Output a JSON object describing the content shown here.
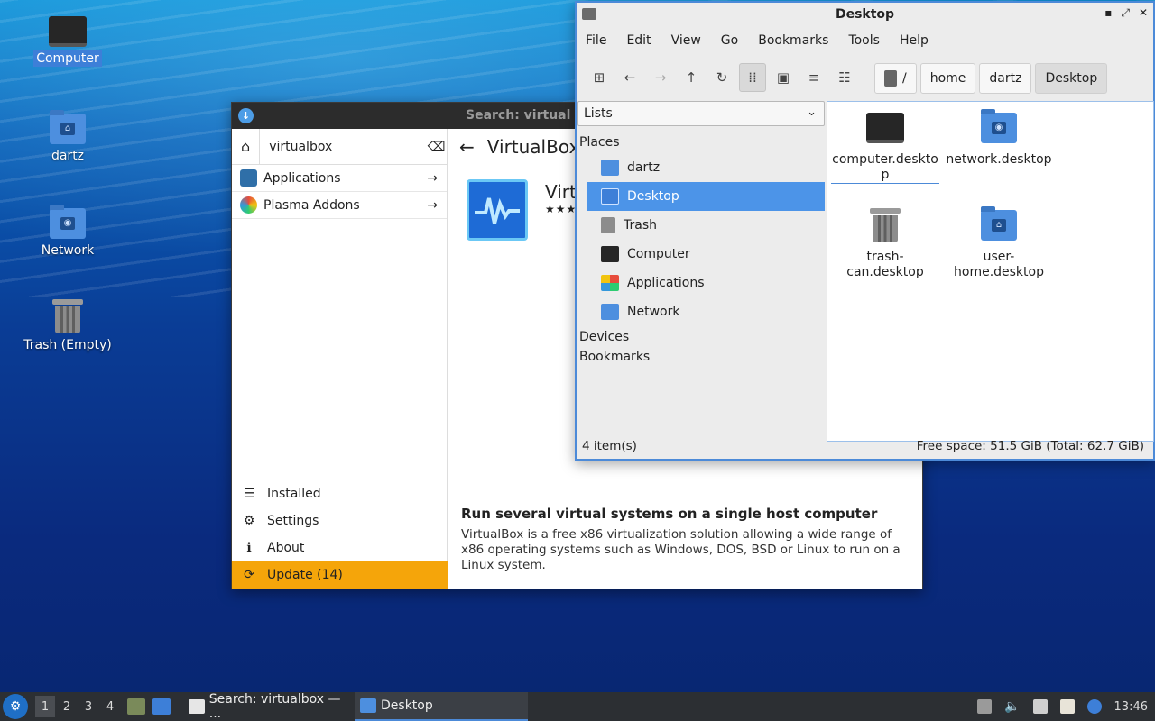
{
  "desktop": {
    "icons": [
      {
        "label": "Computer",
        "icon": "computer-icon"
      },
      {
        "label": "dartz",
        "icon": "home-folder-icon"
      },
      {
        "label": "Network",
        "icon": "network-folder-icon"
      },
      {
        "label": "Trash (Empty)",
        "icon": "trash-icon"
      }
    ]
  },
  "discover": {
    "title": "Search: virtual",
    "search": {
      "value": "virtualbox"
    },
    "categories": [
      {
        "label": "Applications"
      },
      {
        "label": "Plasma Addons"
      }
    ],
    "header": {
      "title": "VirtualBox"
    },
    "app": {
      "name": "Virt",
      "stars": "★★★"
    },
    "nav": [
      {
        "label": "Installed",
        "icon": "list-icon"
      },
      {
        "label": "Settings",
        "icon": "gear-icon"
      },
      {
        "label": "About",
        "icon": "info-icon"
      },
      {
        "label": "Update (14)",
        "icon": "update-icon"
      }
    ],
    "summary": "Run several virtual systems on a single host computer",
    "description": "VirtualBox is a free x86 virtualization solution allowing a wide range of x86 operating systems such as Windows, DOS, BSD or Linux to run on a Linux system."
  },
  "filemanager": {
    "title": "Desktop",
    "menu": [
      "File",
      "Edit",
      "View",
      "Go",
      "Bookmarks",
      "Tools",
      "Help"
    ],
    "path": [
      "/",
      "home",
      "dartz",
      "Desktop"
    ],
    "side_mode": "Lists",
    "sections": {
      "places": "Places",
      "devices": "Devices",
      "bookmarks": "Bookmarks"
    },
    "places": [
      {
        "label": "dartz"
      },
      {
        "label": "Desktop"
      },
      {
        "label": "Trash"
      },
      {
        "label": "Computer"
      },
      {
        "label": "Applications"
      },
      {
        "label": "Network"
      }
    ],
    "files": [
      {
        "name": "computer.deskto\np"
      },
      {
        "name": "network.desktop"
      },
      {
        "name": "trash-\ncan.desktop"
      },
      {
        "name": "user-\nhome.desktop"
      }
    ],
    "status": {
      "count": "4 item(s)",
      "space": "Free space: 51.5 GiB (Total: 62.7 GiB)"
    }
  },
  "taskbar": {
    "workspaces": [
      "1",
      "2",
      "3",
      "4"
    ],
    "tasks": [
      {
        "label": "Search: virtualbox — ..."
      },
      {
        "label": "Desktop"
      }
    ],
    "clock": "13:46"
  }
}
